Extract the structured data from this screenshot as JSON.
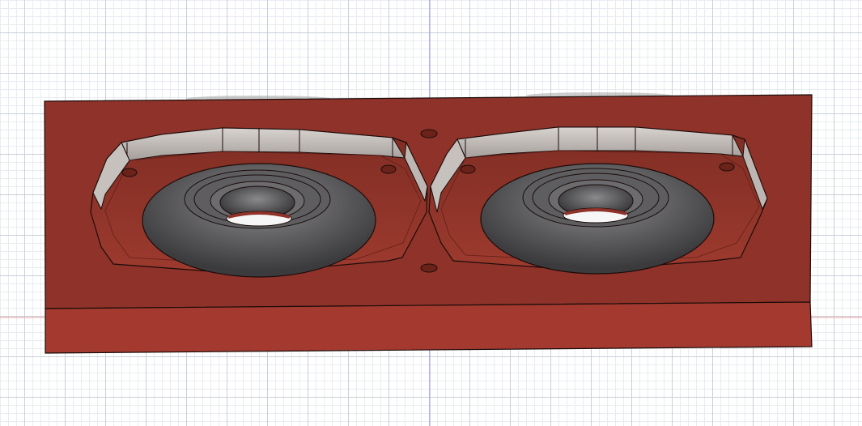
{
  "viewport": {
    "name": "3d-model-viewport",
    "grid": true,
    "origin_axes": true
  },
  "model": {
    "part": "mounting-block",
    "pockets": 2,
    "bearing_rings": 2,
    "holes": 6
  },
  "colors": {
    "block_top": "#8f3229",
    "block_front": "#a43a2f",
    "pocket_floor": "#953428",
    "pocket_wall": "#c8c4c0",
    "bearing_outer": "#59595b",
    "bearing_inner": "#2e2e30",
    "axis_x": "#e06060",
    "axis_y": "#7a7ae0",
    "edge": "#1a0c0a"
  }
}
